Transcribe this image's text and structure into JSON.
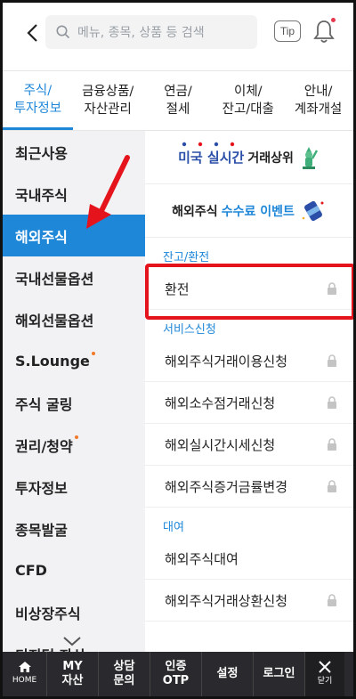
{
  "header": {
    "search_placeholder": "메뉴, 종목, 상품 등 검색",
    "tip_label": "Tip"
  },
  "categories": [
    {
      "label": "주식/\n투자정보",
      "active": true
    },
    {
      "label": "금융상품/\n자산관리",
      "active": false
    },
    {
      "label": "연금/\n절세",
      "active": false
    },
    {
      "label": "이체/\n잔고/대출",
      "active": false
    },
    {
      "label": "안내/\n계좌개설",
      "active": false
    }
  ],
  "leftnav": {
    "items": [
      {
        "label": "최근사용"
      },
      {
        "label": "국내주식"
      },
      {
        "label": "해외주식"
      },
      {
        "label": "국내선물옵션"
      },
      {
        "label": "해외선물옵션"
      },
      {
        "label": "S.Lounge"
      },
      {
        "label": "주식 굴링"
      },
      {
        "label": "권리/청약"
      },
      {
        "label": "투자정보"
      },
      {
        "label": "종목발굴"
      },
      {
        "label": "CFD"
      },
      {
        "label": "비상장주식"
      },
      {
        "label": "디지털 자산"
      }
    ]
  },
  "banners": {
    "realtime_highlight": "미국 실시간",
    "realtime_suffix": "거래상위",
    "fee_prefix": "해외주식",
    "fee_highlight": "수수료 이벤트"
  },
  "sections": {
    "balance_exchange": {
      "title": "잔고/환전",
      "items": [
        {
          "label": "환전"
        }
      ]
    },
    "service_apply": {
      "title": "서비스신청",
      "items": [
        {
          "label": "해외주식거래이용신청"
        },
        {
          "label": "해외소수점거래신청"
        },
        {
          "label": "해외실시간시세신청"
        },
        {
          "label": "해외주식증거금률변경"
        }
      ]
    },
    "lending": {
      "title": "대여",
      "items": [
        {
          "label": "해외주식대여"
        },
        {
          "label": "해외주식거래상환신청"
        }
      ]
    }
  },
  "bottombar": {
    "home": "HOME",
    "my_assets": "MY\n자산",
    "consult": "상담\n문의",
    "otp": "인증\nOTP",
    "settings": "설정",
    "login": "로그인",
    "close": "닫기"
  },
  "colors": {
    "accent": "#1f87d8",
    "highlight_box": "#e5141c",
    "bottom_bar": "#2a2a2e"
  }
}
